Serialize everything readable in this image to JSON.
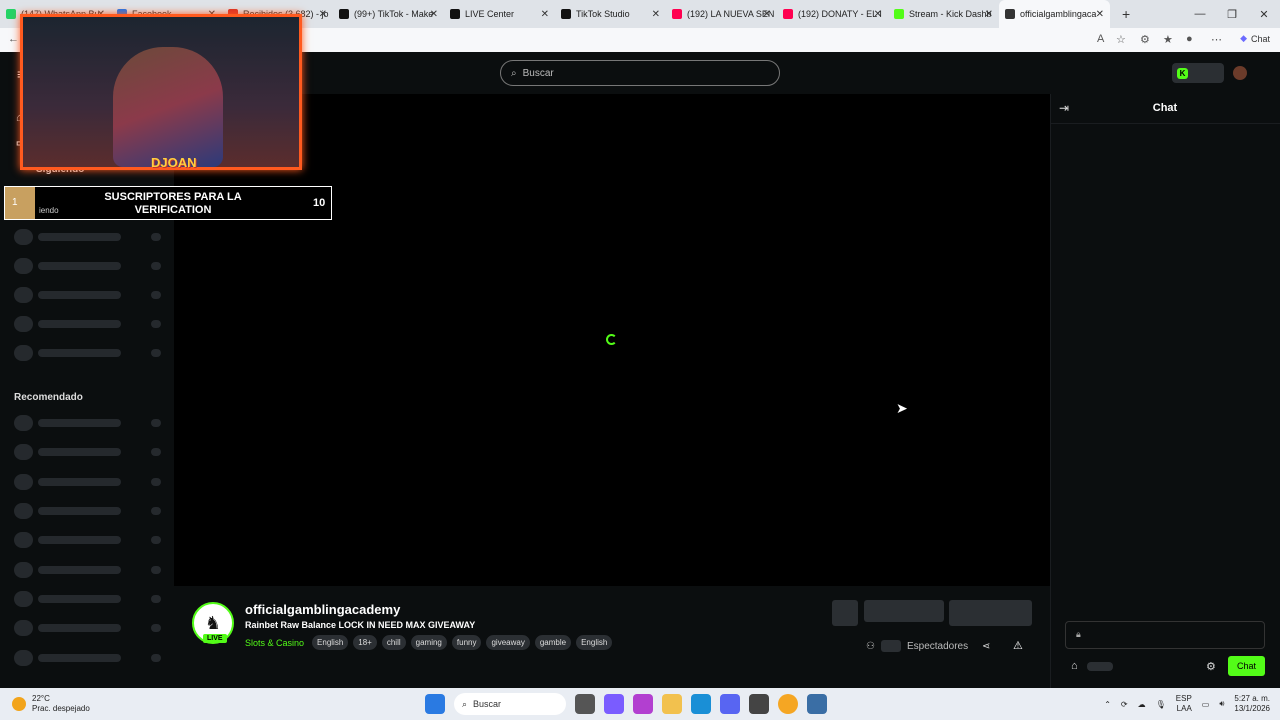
{
  "browser": {
    "tabs": [
      {
        "label": "(147) WhatsApp Bu",
        "color": "#25d366"
      },
      {
        "label": "Facebook",
        "color": "#1877f2"
      },
      {
        "label": "Recibidos (3,682) - jo",
        "color": "#d93025"
      },
      {
        "label": "(99+) TikTok - Make",
        "color": "#111111"
      },
      {
        "label": "LIVE Center",
        "color": "#111111"
      },
      {
        "label": "TikTok Studio",
        "color": "#111111"
      },
      {
        "label": "(192) LA NUEVA SEN",
        "color": "#ff0050"
      },
      {
        "label": "(192) DONATY - EL I",
        "color": "#ff0050"
      },
      {
        "label": "Stream - Kick Dashb",
        "color": "#53fc18"
      },
      {
        "label": "officialgamblingaca",
        "color": "#333333"
      }
    ],
    "chat_label": "Chat"
  },
  "kick": {
    "search_placeholder": "Buscar",
    "sidebar": {
      "following_label": "Siguiendo",
      "recommended_label": "Recomendado"
    },
    "channel": {
      "name": "officialgamblingacademy",
      "title": "Rainbet Raw Balance LOCK IN NEED MAX GIVEAWAY",
      "category": "Slots & Casino",
      "live_badge": "LIVE",
      "tags": [
        "English",
        "18+",
        "chill",
        "gaming",
        "funny",
        "giveaway",
        "gamble",
        "English"
      ],
      "viewers_label": "Espectadores"
    },
    "chat": {
      "title": "Chat",
      "send_label": "Chat"
    }
  },
  "overlay": {
    "webcam_logo": "DJOAN",
    "goal": {
      "current": "1",
      "text": "SUSCRIPTORES PARA LA VERIFICATION",
      "target": "10",
      "partial_label": "iendo"
    }
  },
  "taskbar": {
    "temperature": "22°C",
    "weather": "Prac. despejado",
    "search_label": "Buscar",
    "lang_top": "ESP",
    "lang_bottom": "LAA",
    "time": "5:27 a. m.",
    "date": "13/1/2026"
  },
  "colors": {
    "accent": "#53fc18",
    "overlay_border": "#ff5a1f"
  }
}
